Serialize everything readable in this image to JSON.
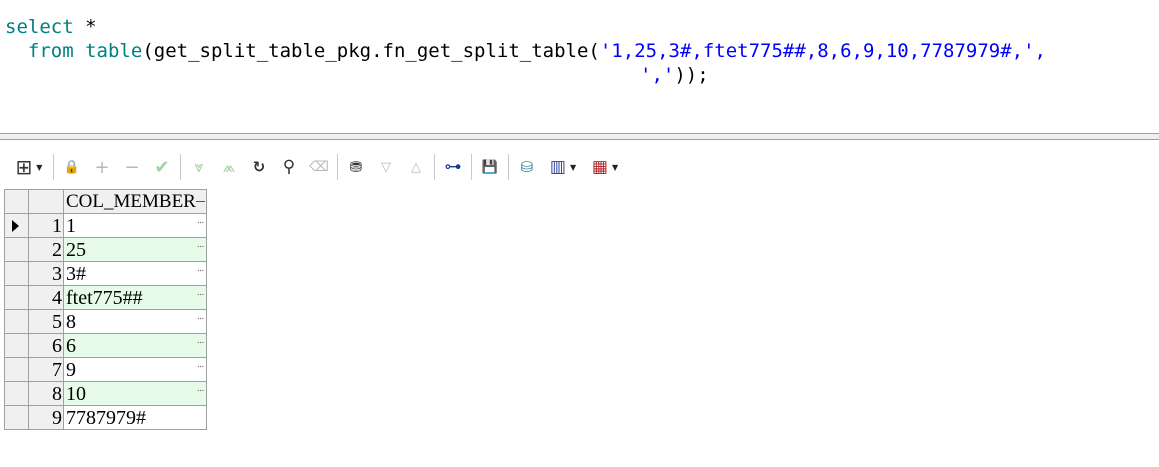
{
  "editor": {
    "line1_kw": "select",
    "line1_op": " *",
    "line2_indent": "  ",
    "line2_kw": "from",
    "line2_sp": " ",
    "line2_kw2": "table",
    "line2_fn": "(get_split_table_pkg.fn_get_split_table(",
    "line2_str": "'1,25,3#,ftet775##,8,6,9,10,7787979#,',",
    "line3_str": "','",
    "line3_end": "));"
  },
  "toolbar": {
    "icons": [
      "grid-icon",
      "lock-icon",
      "add-icon",
      "remove-icon",
      "check-icon",
      "fetch-next-icon",
      "fetch-last-icon",
      "refresh-icon",
      "find-icon",
      "clear-icon",
      "query-icon",
      "sort-down-icon",
      "sort-up-icon",
      "tree-icon",
      "save-icon",
      "export-icon",
      "chart-icon",
      "table-icon"
    ],
    "glyphs": {
      "grid": "⊞",
      "lock": "🔒",
      "add": "+",
      "remove": "−",
      "check": "✔",
      "next": "⩔",
      "last": "⩕",
      "refresh": "↻",
      "find": "⚲",
      "clear": "⌫",
      "query": "⛃",
      "down": "▽",
      "up": "△",
      "tree": "⊶",
      "save": "💾",
      "export": "⛁",
      "chart": "▥",
      "table": "▦",
      "dropdown": "▼"
    }
  },
  "grid": {
    "column_header": "COL_MEMBER",
    "ellipsis": "...",
    "rows": [
      {
        "n": "1",
        "v": "1"
      },
      {
        "n": "2",
        "v": "25"
      },
      {
        "n": "3",
        "v": "3#"
      },
      {
        "n": "4",
        "v": "ftet775##"
      },
      {
        "n": "5",
        "v": "8"
      },
      {
        "n": "6",
        "v": "6"
      },
      {
        "n": "7",
        "v": "9"
      },
      {
        "n": "8",
        "v": "10"
      },
      {
        "n": "9",
        "v": "7787979#"
      }
    ]
  }
}
